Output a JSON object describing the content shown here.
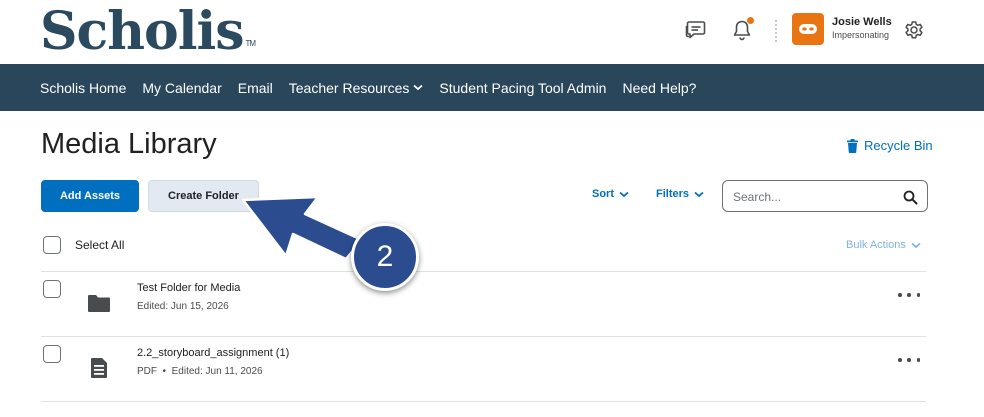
{
  "header": {
    "logo_text": "Scholis",
    "logo_tm": "TM",
    "user_name": "Josie Wells",
    "user_status": "Impersonating",
    "icons": [
      "message-icon",
      "bell-icon",
      "gear-icon"
    ],
    "notification_dot_color": "#e87511",
    "avatar_color": "#e87511"
  },
  "nav": {
    "items": [
      {
        "label": "Scholis Home"
      },
      {
        "label": "My Calendar"
      },
      {
        "label": "Email"
      },
      {
        "label": "Teacher Resources"
      },
      {
        "label": "Student Pacing Tool Admin"
      },
      {
        "label": "Need Help?"
      }
    ],
    "background": "#29465b"
  },
  "page": {
    "title": "Media Library",
    "recycle_bin": "Recycle Bin"
  },
  "toolbar": {
    "add_assets": "Add Assets",
    "create_folder": "Create Folder",
    "sort": "Sort",
    "filters": "Filters",
    "search_placeholder": "Search...",
    "accent": "#006fbf"
  },
  "list": {
    "select_all": "Select All",
    "bulk_actions": "Bulk Actions",
    "items": [
      {
        "title": "Test Folder for Media",
        "meta": "Edited: Jun 15, 2026",
        "icon": "folder-icon"
      },
      {
        "title": "2.2_storyboard_assignment (1)",
        "meta": "PDF  •  Edited: Jun 11, 2026",
        "icon": "document-icon"
      }
    ]
  },
  "annotation": {
    "step_number": "2",
    "color": "#2b4c8f"
  }
}
